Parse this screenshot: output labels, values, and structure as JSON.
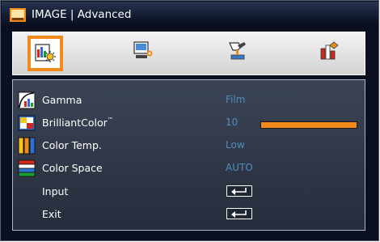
{
  "window": {
    "title": "IMAGE | Advanced",
    "title_icon": "image-menu-icon"
  },
  "tabs": [
    {
      "icon": "image-settings-icon",
      "selected": true
    },
    {
      "icon": "display-settings-icon",
      "selected": false
    },
    {
      "icon": "setup-icon",
      "selected": false
    },
    {
      "icon": "options-info-icon",
      "selected": false
    }
  ],
  "menu": {
    "items": [
      {
        "label": "Gamma",
        "value": "Film",
        "icon": "gamma-icon"
      },
      {
        "label": "BrilliantColor",
        "trademark": "™",
        "value": "10",
        "level_fraction": 1.0,
        "icon": "brilliantcolor-icon"
      },
      {
        "label": "Color Temp.",
        "value": "Low",
        "icon": "color-temp-icon"
      },
      {
        "label": "Color Space",
        "value": "AUTO",
        "icon": "color-space-icon"
      },
      {
        "label": "Input",
        "control": "enter-icon"
      },
      {
        "label": "Exit",
        "control": "enter-icon"
      }
    ]
  },
  "colors": {
    "accent": "#f08a1a",
    "value_text": "#4f8dbf",
    "menu_background": "#2e3646"
  }
}
